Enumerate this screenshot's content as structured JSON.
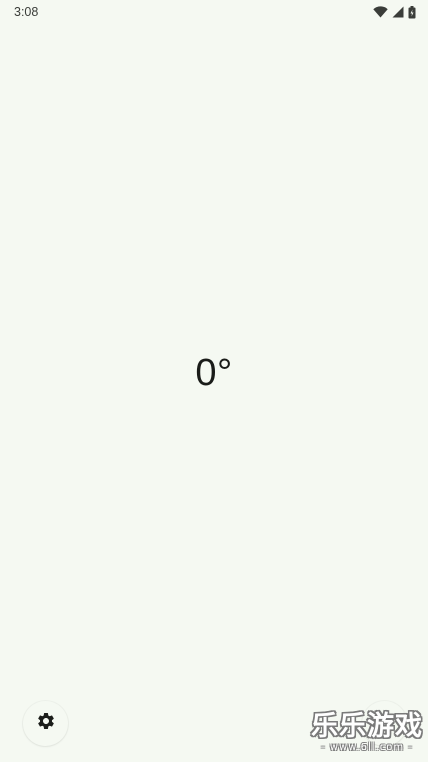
{
  "status_bar": {
    "time": "3:08",
    "icons": [
      "wifi-icon",
      "cell-signal-icon",
      "battery-icon"
    ]
  },
  "main": {
    "angle_readout": "0°"
  },
  "bottom_bar": {
    "left_button_icon": "gear-icon",
    "right_button_icon": "grid-icon"
  },
  "watermark": {
    "title": "乐乐游戏",
    "url": "- www.6ll.com -"
  },
  "colors": {
    "background": "#f5f9f2",
    "text": "#1a1c19"
  }
}
